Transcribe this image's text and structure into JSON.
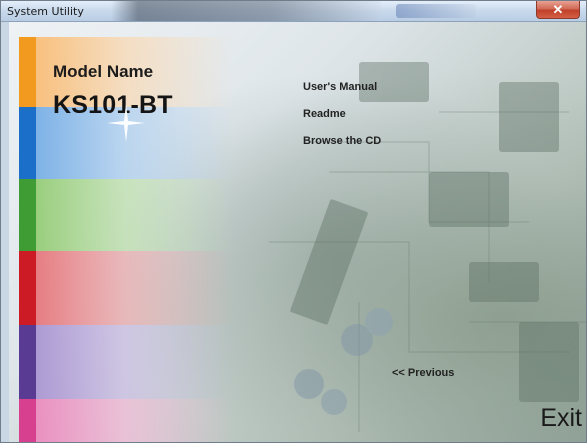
{
  "window": {
    "title": "System Utility",
    "close_glyph": "✕"
  },
  "model": {
    "label": "Model Name",
    "value": "KS101-BT"
  },
  "menu": {
    "items": [
      "User's Manual",
      "Readme",
      "Browse the CD"
    ]
  },
  "nav": {
    "previous": "<< Previous",
    "exit": "Exit"
  },
  "colors": {
    "orange": "#f29a1f",
    "blue": "#1c6fc9",
    "green": "#3f9b34",
    "red": "#cc1b24",
    "purple": "#5a3b93",
    "pink": "#d73f8f",
    "close_button": "#c0402a"
  }
}
